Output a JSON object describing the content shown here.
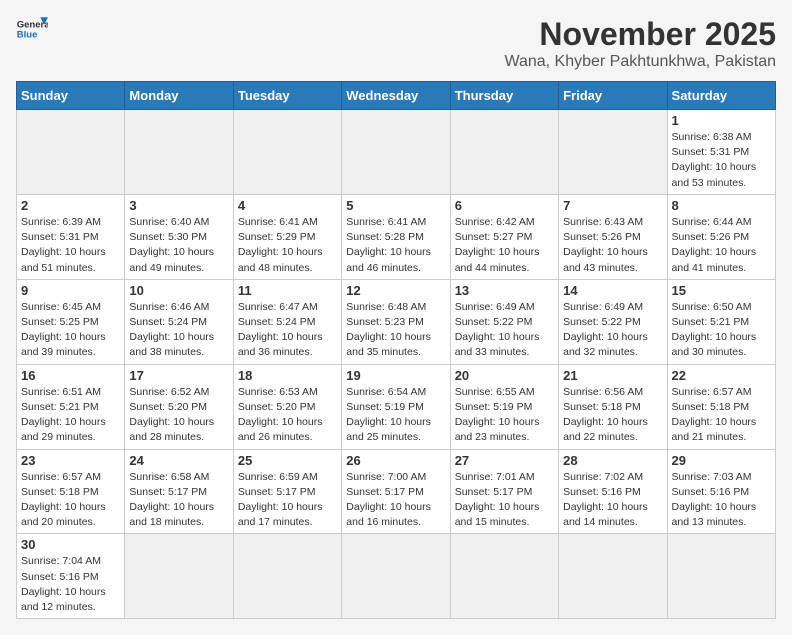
{
  "header": {
    "logo_general": "General",
    "logo_blue": "Blue",
    "month_year": "November 2025",
    "location": "Wana, Khyber Pakhtunkhwa, Pakistan"
  },
  "days_of_week": [
    "Sunday",
    "Monday",
    "Tuesday",
    "Wednesday",
    "Thursday",
    "Friday",
    "Saturday"
  ],
  "weeks": [
    [
      {
        "day": "",
        "info": ""
      },
      {
        "day": "",
        "info": ""
      },
      {
        "day": "",
        "info": ""
      },
      {
        "day": "",
        "info": ""
      },
      {
        "day": "",
        "info": ""
      },
      {
        "day": "",
        "info": ""
      },
      {
        "day": "1",
        "info": "Sunrise: 6:38 AM\nSunset: 5:31 PM\nDaylight: 10 hours and 53 minutes."
      }
    ],
    [
      {
        "day": "2",
        "info": "Sunrise: 6:39 AM\nSunset: 5:31 PM\nDaylight: 10 hours and 51 minutes."
      },
      {
        "day": "3",
        "info": "Sunrise: 6:40 AM\nSunset: 5:30 PM\nDaylight: 10 hours and 49 minutes."
      },
      {
        "day": "4",
        "info": "Sunrise: 6:41 AM\nSunset: 5:29 PM\nDaylight: 10 hours and 48 minutes."
      },
      {
        "day": "5",
        "info": "Sunrise: 6:41 AM\nSunset: 5:28 PM\nDaylight: 10 hours and 46 minutes."
      },
      {
        "day": "6",
        "info": "Sunrise: 6:42 AM\nSunset: 5:27 PM\nDaylight: 10 hours and 44 minutes."
      },
      {
        "day": "7",
        "info": "Sunrise: 6:43 AM\nSunset: 5:26 PM\nDaylight: 10 hours and 43 minutes."
      },
      {
        "day": "8",
        "info": "Sunrise: 6:44 AM\nSunset: 5:26 PM\nDaylight: 10 hours and 41 minutes."
      }
    ],
    [
      {
        "day": "9",
        "info": "Sunrise: 6:45 AM\nSunset: 5:25 PM\nDaylight: 10 hours and 39 minutes."
      },
      {
        "day": "10",
        "info": "Sunrise: 6:46 AM\nSunset: 5:24 PM\nDaylight: 10 hours and 38 minutes."
      },
      {
        "day": "11",
        "info": "Sunrise: 6:47 AM\nSunset: 5:24 PM\nDaylight: 10 hours and 36 minutes."
      },
      {
        "day": "12",
        "info": "Sunrise: 6:48 AM\nSunset: 5:23 PM\nDaylight: 10 hours and 35 minutes."
      },
      {
        "day": "13",
        "info": "Sunrise: 6:49 AM\nSunset: 5:22 PM\nDaylight: 10 hours and 33 minutes."
      },
      {
        "day": "14",
        "info": "Sunrise: 6:49 AM\nSunset: 5:22 PM\nDaylight: 10 hours and 32 minutes."
      },
      {
        "day": "15",
        "info": "Sunrise: 6:50 AM\nSunset: 5:21 PM\nDaylight: 10 hours and 30 minutes."
      }
    ],
    [
      {
        "day": "16",
        "info": "Sunrise: 6:51 AM\nSunset: 5:21 PM\nDaylight: 10 hours and 29 minutes."
      },
      {
        "day": "17",
        "info": "Sunrise: 6:52 AM\nSunset: 5:20 PM\nDaylight: 10 hours and 28 minutes."
      },
      {
        "day": "18",
        "info": "Sunrise: 6:53 AM\nSunset: 5:20 PM\nDaylight: 10 hours and 26 minutes."
      },
      {
        "day": "19",
        "info": "Sunrise: 6:54 AM\nSunset: 5:19 PM\nDaylight: 10 hours and 25 minutes."
      },
      {
        "day": "20",
        "info": "Sunrise: 6:55 AM\nSunset: 5:19 PM\nDaylight: 10 hours and 23 minutes."
      },
      {
        "day": "21",
        "info": "Sunrise: 6:56 AM\nSunset: 5:18 PM\nDaylight: 10 hours and 22 minutes."
      },
      {
        "day": "22",
        "info": "Sunrise: 6:57 AM\nSunset: 5:18 PM\nDaylight: 10 hours and 21 minutes."
      }
    ],
    [
      {
        "day": "23",
        "info": "Sunrise: 6:57 AM\nSunset: 5:18 PM\nDaylight: 10 hours and 20 minutes."
      },
      {
        "day": "24",
        "info": "Sunrise: 6:58 AM\nSunset: 5:17 PM\nDaylight: 10 hours and 18 minutes."
      },
      {
        "day": "25",
        "info": "Sunrise: 6:59 AM\nSunset: 5:17 PM\nDaylight: 10 hours and 17 minutes."
      },
      {
        "day": "26",
        "info": "Sunrise: 7:00 AM\nSunset: 5:17 PM\nDaylight: 10 hours and 16 minutes."
      },
      {
        "day": "27",
        "info": "Sunrise: 7:01 AM\nSunset: 5:17 PM\nDaylight: 10 hours and 15 minutes."
      },
      {
        "day": "28",
        "info": "Sunrise: 7:02 AM\nSunset: 5:16 PM\nDaylight: 10 hours and 14 minutes."
      },
      {
        "day": "29",
        "info": "Sunrise: 7:03 AM\nSunset: 5:16 PM\nDaylight: 10 hours and 13 minutes."
      }
    ],
    [
      {
        "day": "30",
        "info": "Sunrise: 7:04 AM\nSunset: 5:16 PM\nDaylight: 10 hours and 12 minutes."
      },
      {
        "day": "",
        "info": ""
      },
      {
        "day": "",
        "info": ""
      },
      {
        "day": "",
        "info": ""
      },
      {
        "day": "",
        "info": ""
      },
      {
        "day": "",
        "info": ""
      },
      {
        "day": "",
        "info": ""
      }
    ]
  ]
}
